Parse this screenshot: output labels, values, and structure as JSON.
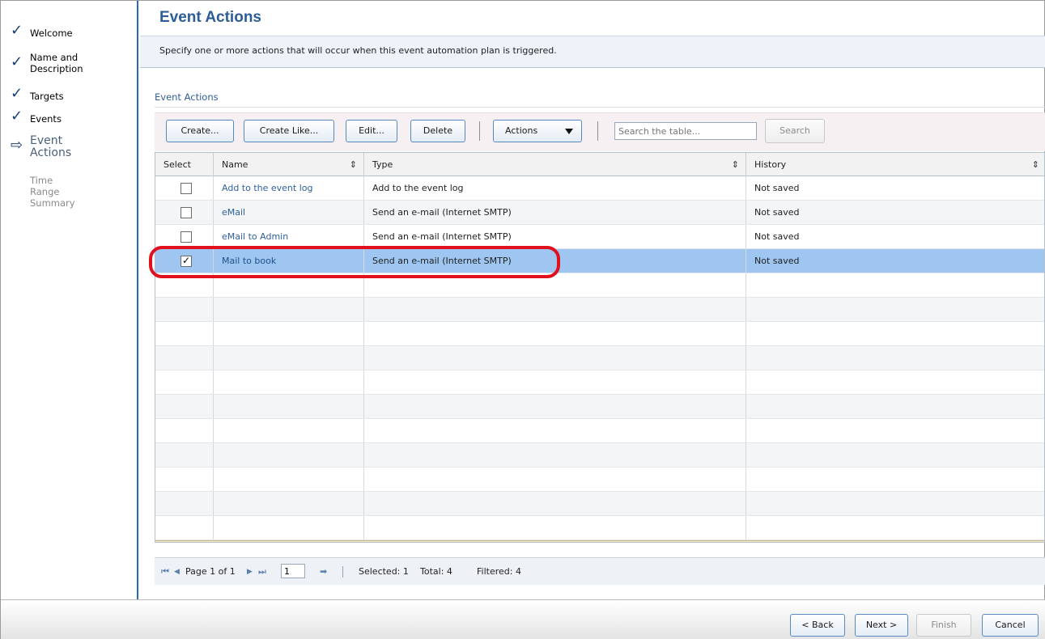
{
  "wizard": {
    "steps": [
      {
        "label": "Welcome",
        "state": "done"
      },
      {
        "label": "Name and\nDescription",
        "state": "done"
      },
      {
        "label": "Targets",
        "state": "done"
      },
      {
        "label": "Events",
        "state": "done"
      },
      {
        "label": "Event\nActions",
        "state": "current"
      },
      {
        "label": "Time Range",
        "state": "todo"
      },
      {
        "label": "Summary",
        "state": "todo"
      }
    ],
    "done_mark": "✓",
    "current_mark": "⇨"
  },
  "page": {
    "title": "Event Actions",
    "description": "Specify one or more actions that will occur when this event automation plan is triggered.",
    "section_label": "Event Actions"
  },
  "toolbar": {
    "create": "Create...",
    "create_like": "Create Like...",
    "edit": "Edit...",
    "delete": "Delete",
    "actions": "Actions",
    "search_placeholder": "Search the table...",
    "search_button": "Search"
  },
  "table": {
    "columns": [
      "Select",
      "Name",
      "Type",
      "History"
    ],
    "sort_glyph": "⇕",
    "rows": [
      {
        "name": "Add to the event log",
        "type": "Add to the event log",
        "history": "Not saved",
        "selected": false
      },
      {
        "name": "eMail",
        "type": "Send an e-mail (Internet SMTP)",
        "history": "Not saved",
        "selected": false
      },
      {
        "name": "eMail to Admin",
        "type": "Send an e-mail (Internet SMTP)",
        "history": "Not saved",
        "selected": false
      },
      {
        "name": "Mail to book",
        "type": "Send an e-mail (Internet SMTP)",
        "history": "Not saved",
        "selected": true
      }
    ]
  },
  "pager": {
    "first": "⏮",
    "prev": "◀",
    "page_label": "Page 1 of 1",
    "next": "▶",
    "last": "⏭",
    "page_value": "1",
    "go": "➡",
    "selected": "Selected: 1",
    "total": "Total: 4",
    "filtered": "Filtered: 4"
  },
  "footer": {
    "back": "< Back",
    "next": "Next >",
    "finish": "Finish",
    "cancel": "Cancel"
  },
  "colors": {
    "accent": "#2c5d96",
    "selected_row": "#9ec6f0",
    "highlight": "#e0101c"
  }
}
